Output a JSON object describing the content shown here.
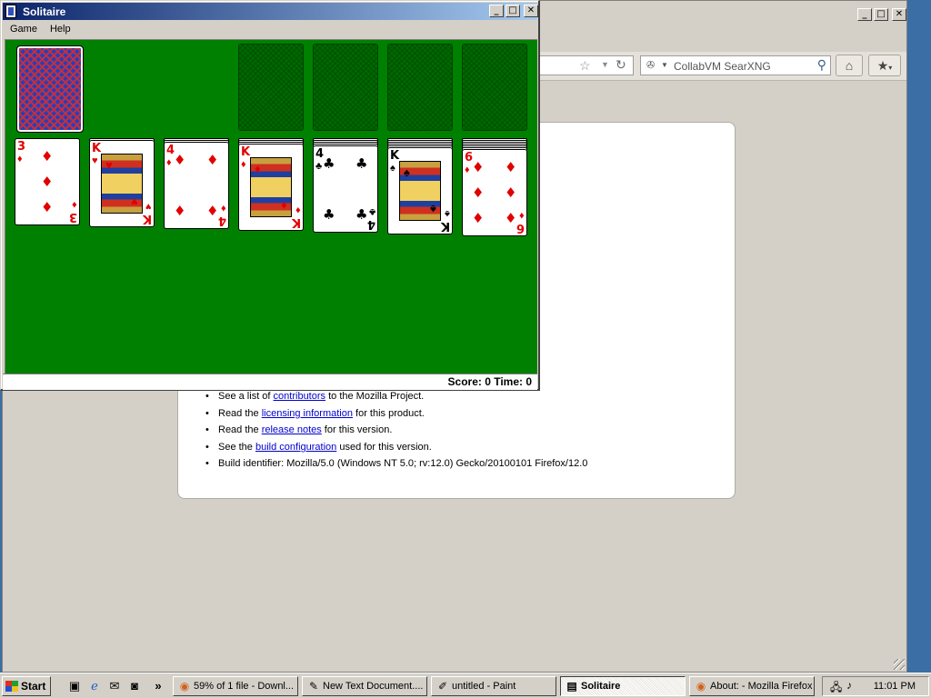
{
  "firefox": {
    "search_placeholder": "CollabVM SearXNG",
    "about_items": [
      {
        "before": "See a list of ",
        "link": "contributors",
        "after": " to the Mozilla Project."
      },
      {
        "before": "Read the ",
        "link": "licensing information",
        "after": " for this product."
      },
      {
        "before": "Read the ",
        "link": "release notes",
        "after": " for this version."
      },
      {
        "before": "See the ",
        "link": "build configuration",
        "after": " used for this version."
      },
      {
        "before": "Build identifier: Mozilla/5.0 (Windows NT 5.0; rv:12.0) Gecko/20100101 Firefox/12.0",
        "link": "",
        "after": ""
      }
    ]
  },
  "solitaire": {
    "title": "Solitaire",
    "menu": [
      "Game",
      "Help"
    ],
    "status": "Score: 0 Time: 0",
    "tableau": [
      {
        "rank": "3",
        "suit": "♦",
        "color": "red"
      },
      {
        "rank": "K",
        "suit": "♥",
        "color": "red"
      },
      {
        "rank": "4",
        "suit": "♦",
        "color": "red"
      },
      {
        "rank": "K",
        "suit": "♦",
        "color": "red"
      },
      {
        "rank": "4",
        "suit": "♣",
        "color": "black"
      },
      {
        "rank": "K",
        "suit": "♠",
        "color": "black"
      },
      {
        "rank": "6",
        "suit": "♦",
        "color": "red"
      }
    ]
  },
  "taskbar": {
    "start_label": "Start",
    "tasks": [
      {
        "label": "59% of 1 file - Downl...",
        "icon": "firefox-icon",
        "active": false
      },
      {
        "label": "New Text Document....",
        "icon": "notepad-icon",
        "active": false
      },
      {
        "label": "untitled - Paint",
        "icon": "paint-icon",
        "active": false
      },
      {
        "label": "Solitaire",
        "icon": "solitaire-icon",
        "active": true
      },
      {
        "label": "About: - Mozilla Firefox",
        "icon": "firefox-icon",
        "active": false
      }
    ],
    "clock": "11:01 PM"
  }
}
